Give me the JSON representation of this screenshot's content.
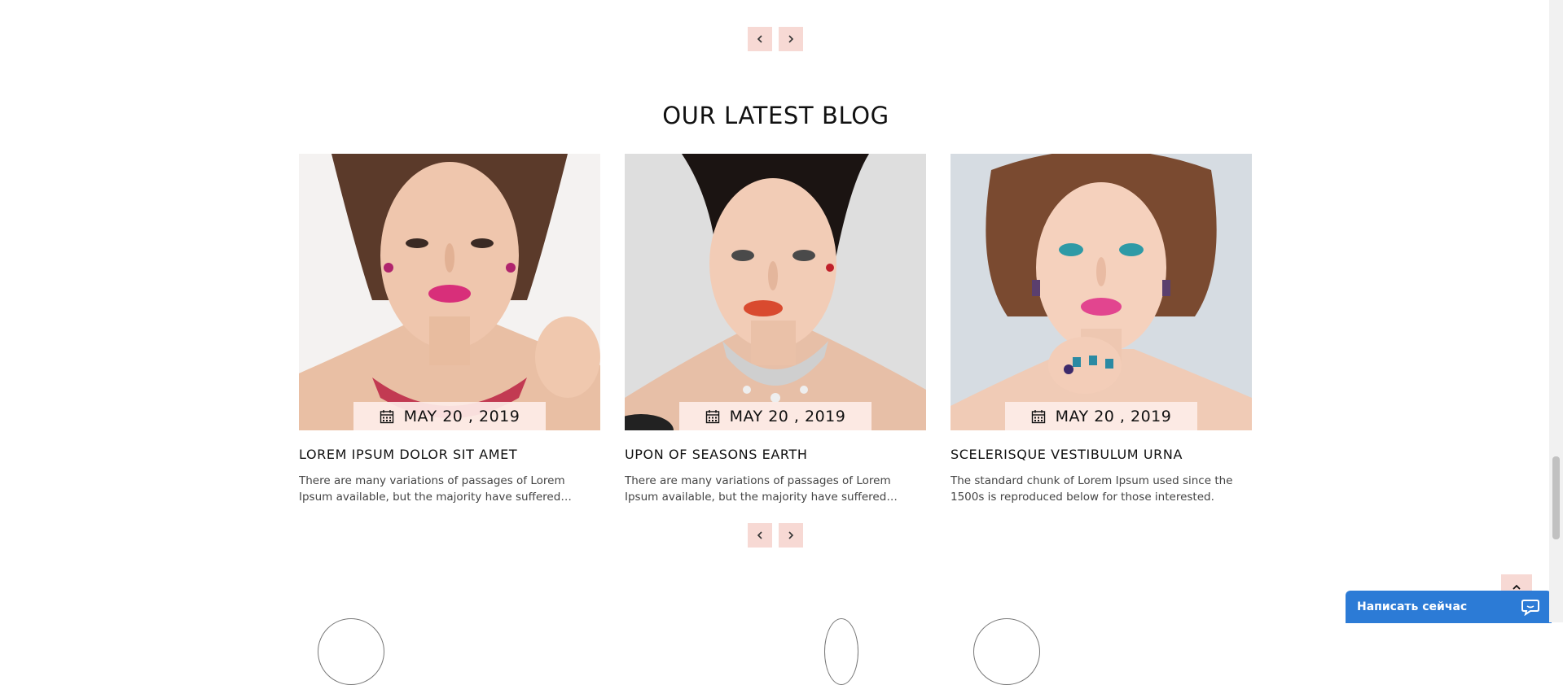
{
  "section": {
    "title": "OUR LATEST BLOG"
  },
  "nav": {
    "prev_icon": "chevron-left-icon",
    "next_icon": "chevron-right-icon"
  },
  "posts": [
    {
      "date": "MAY 20 , 2019",
      "title": "LOREM IPSUM DOLOR SIT AMET",
      "excerpt": "There are many variations of passages of Lorem Ipsum available, but the majority have suffered alteration in some form."
    },
    {
      "date": "MAY 20 , 2019",
      "title": "UPON OF SEASONS EARTH",
      "excerpt": "There are many variations of passages of Lorem Ipsum available, but the majority have suffered alteration in some form."
    },
    {
      "date": "MAY 20 , 2019",
      "title": "SCELERISQUE VESTIBULUM URNA",
      "excerpt": "The standard chunk of Lorem Ipsum used since the 1500s is reproduced below for those interested."
    }
  ],
  "chat": {
    "label": "Написать сейчас",
    "icon": "chat-bubble-icon"
  },
  "colors": {
    "accent": "#f7d9d4",
    "badge": "#fdece7",
    "chat": "#2c7bd6"
  }
}
